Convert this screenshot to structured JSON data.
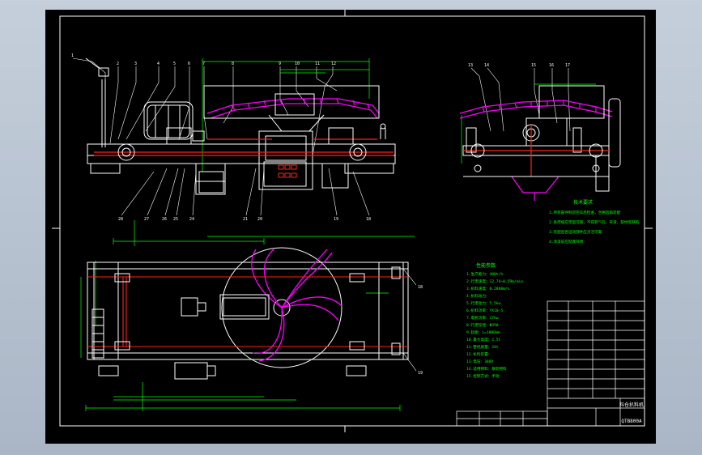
{
  "colors": {
    "background": "#000000",
    "line": "#ffffff",
    "dimension": "#00ff00",
    "highlight": "#ff00ff",
    "mechanism": "#ff2020",
    "text_green": "#00ff00"
  },
  "views": {
    "front_view": "front-elevation",
    "side_view": "side-elevation",
    "plan_view": "plan-view"
  },
  "callouts": {
    "front_top": [
      "1",
      "2",
      "3",
      "4",
      "5",
      "6",
      "7",
      "8",
      "9",
      "10",
      "11",
      "12"
    ],
    "front_bottom": [
      "28",
      "27",
      "26",
      "25",
      "24",
      "21",
      "20",
      "19",
      "18"
    ],
    "side_top": [
      "13",
      "14",
      "15",
      "16",
      "17"
    ],
    "plan_right": [
      "18",
      "19"
    ]
  },
  "notes": {
    "tech_requirements_title": "技术要求",
    "tech_requirements": [
      "1.所有部件制造完毕后检查，合格后再装配",
      "2.各焊缝应牢固可靠，不得有气孔、夹渣、裂纹等缺陷",
      "3.装配后各运动部件应灵活可靠",
      "4.涂漆前应彻底除锈"
    ],
    "params_title": "性能参数",
    "params": [
      "1.生产能力：400t/h",
      "2.行走速度：12.74~0.59m/min",
      "3.扒料速度：0.2888m/s",
      "4.扒料动力：",
      "5.行走动力：5.5kw",
      "6.扒料功率：YX10-5",
      "7.电机功率：37kw",
      "8.行走轮径：Φ350",
      "9.轨距：L=1800mm",
      "10.最大高度：2.5t",
      "11.整机质量：24t",
      "12.扒料装置：",
      "13.电压：380V",
      "14.适用物料：散装物料",
      "15.控制方式：手动"
    ]
  },
  "title_block": {
    "drawing_title": "料仓扒料机",
    "drawing_code": "QTB800A"
  }
}
